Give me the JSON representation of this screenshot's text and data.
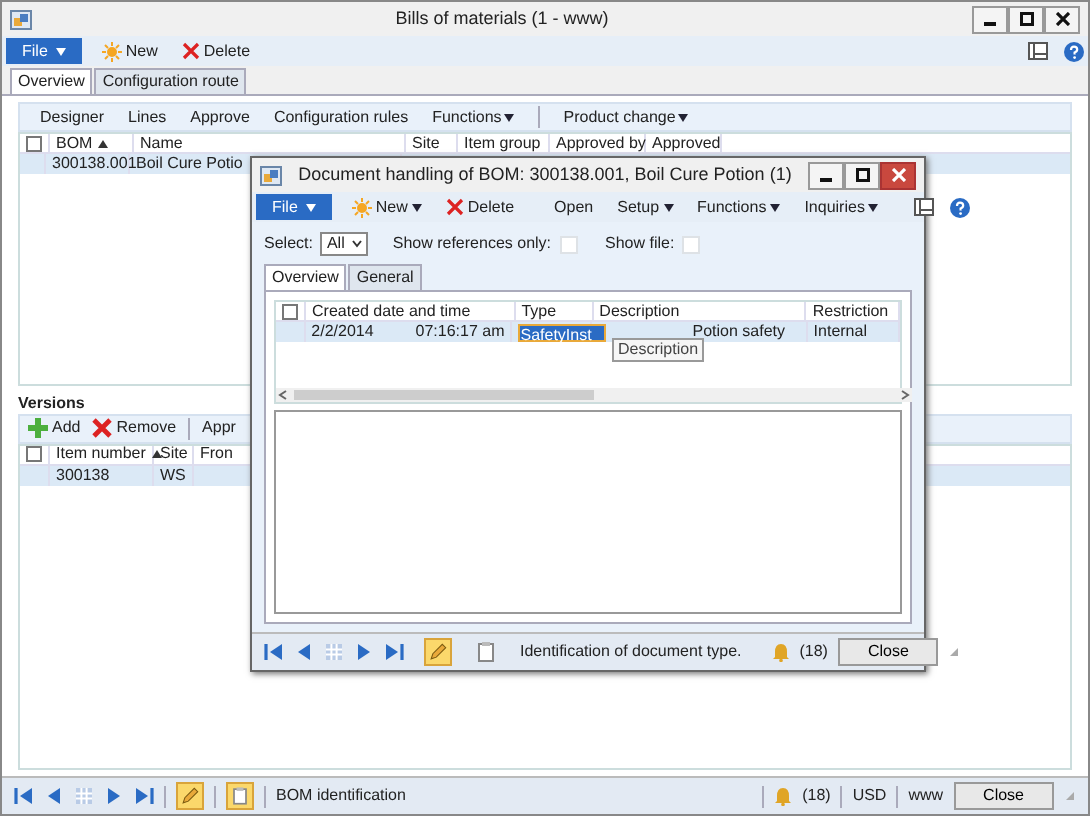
{
  "window": {
    "title": "Bills of materials (1 - www)"
  },
  "toolbar": {
    "file": "File",
    "buttons": [
      {
        "label": "New",
        "dropdown": false
      },
      {
        "label": "Delete",
        "dropdown": false
      }
    ]
  },
  "tabs": [
    {
      "label": "Overview",
      "selected": true
    },
    {
      "label": "Configuration route",
      "selected": false
    }
  ],
  "action_pane": [
    {
      "label": "Designer",
      "dropdown": false
    },
    {
      "label": "Lines",
      "dropdown": false
    },
    {
      "label": "Approve",
      "dropdown": false
    },
    {
      "label": "Configuration rules",
      "dropdown": false
    },
    {
      "label": "Functions",
      "dropdown": true
    },
    {
      "label": "Product change",
      "dropdown": true
    }
  ],
  "bom_grid": {
    "select_all_checked": false,
    "columns": [
      {
        "label": "BOM",
        "sorted": true
      },
      {
        "label": "Name",
        "sorted": false
      },
      {
        "label": "Site",
        "sorted": false
      },
      {
        "label": "Item group",
        "sorted": false
      },
      {
        "label": "Approved by",
        "sorted": false
      },
      {
        "label": "Approved",
        "sorted": false
      }
    ],
    "rows": [
      {
        "cells": [
          "300138.001",
          "Boil Cure Potio"
        ],
        "selected": true
      }
    ]
  },
  "versions": {
    "title": "Versions",
    "buttons": [
      {
        "label": "Add"
      },
      {
        "label": "Remove"
      },
      {
        "label": "Appr"
      }
    ],
    "select_all_checked": false,
    "columns": [
      {
        "label": "Item number",
        "sorted": true
      },
      {
        "label": "Site",
        "sorted": false
      },
      {
        "label": "Fron",
        "sorted": false
      }
    ],
    "rows": [
      {
        "cells": [
          "300138",
          "WS"
        ],
        "selected": true
      }
    ]
  },
  "status_bar": {
    "text": "BOM identification",
    "edit_mode": true,
    "attachments": true,
    "alerts": "(18)",
    "currency": "USD",
    "company": "www",
    "close": "Close"
  },
  "dialog": {
    "title": "Document handling of BOM: 300138.001, Boil Cure Potion (1)",
    "toolbar": {
      "file": "File",
      "buttons": [
        {
          "label": "New",
          "dropdown": true
        },
        {
          "label": "Delete",
          "dropdown": false
        },
        {
          "label": "Open",
          "dropdown": false
        },
        {
          "label": "Setup",
          "dropdown": true
        },
        {
          "label": "Functions",
          "dropdown": true
        },
        {
          "label": "Inquiries",
          "dropdown": true
        }
      ]
    },
    "select": {
      "label": "Select:",
      "value": "All"
    },
    "show_references": {
      "label": "Show references only:",
      "checked": false
    },
    "show_file": {
      "label": "Show file:",
      "checked": false
    },
    "tabs": [
      {
        "label": "Overview",
        "selected": true
      },
      {
        "label": "General",
        "selected": false
      }
    ],
    "grid": {
      "select_all_checked": false,
      "columns": [
        {
          "label": "Created date and time"
        },
        {
          "label": "Type"
        },
        {
          "label": "Description"
        },
        {
          "label": "Restriction"
        }
      ],
      "rows": [
        {
          "date": "2/2/2014",
          "time": "07:16:17 am",
          "type": "SafetyInst",
          "description": "Potion safety",
          "restriction": "Internal",
          "selected": true
        }
      ]
    },
    "tooltip": "Description",
    "status_bar": {
      "text": "Identification of document type.",
      "edit_mode": true,
      "attachments": false,
      "alerts": "(18)",
      "close": "Close"
    }
  }
}
